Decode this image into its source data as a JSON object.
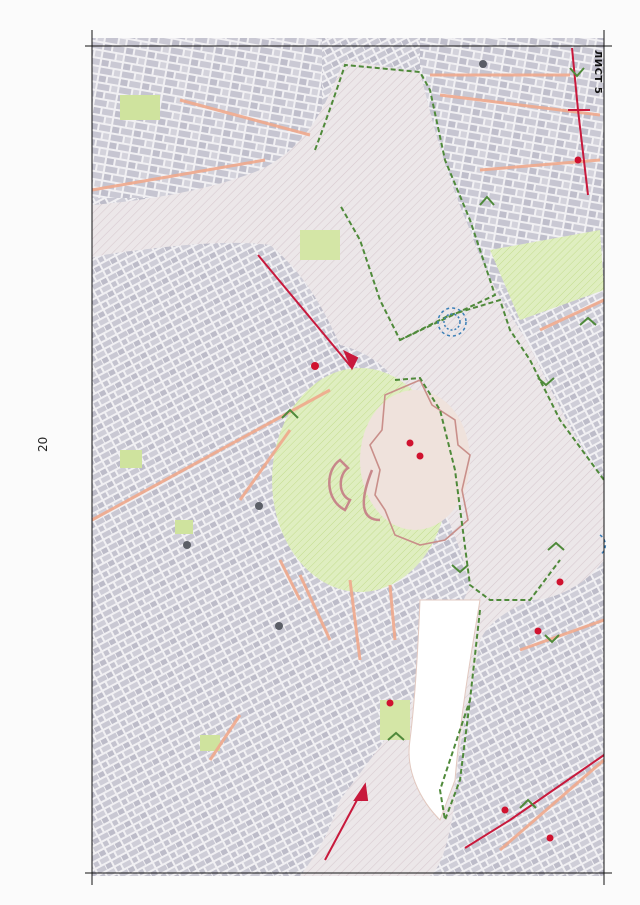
{
  "page": {
    "number": "20",
    "sheet_label": "ЛИСТ 5"
  },
  "map": {
    "colors": {
      "background": "#f2f1f3",
      "water": "#e9e4e6",
      "water_hatch": "#d9ccd0",
      "building": "#c9c8d3",
      "building_dark": "#b8b7c4",
      "green": "#d4e6a6",
      "green_dark": "#b6d37a",
      "protection_zone": "#f2d7c8",
      "street_highlight": "#f0a98c",
      "boundary_green": "#4f8a3a",
      "accent_red": "#c8193c",
      "point_red": "#d0122f",
      "point_gray": "#5b5e66",
      "view_blue": "#3b7fb7",
      "frame": "#111111"
    },
    "legend_features": [
      "protected-view-sector",
      "fortress-boundary",
      "landmark-point",
      "view-direction-arrow"
    ]
  }
}
